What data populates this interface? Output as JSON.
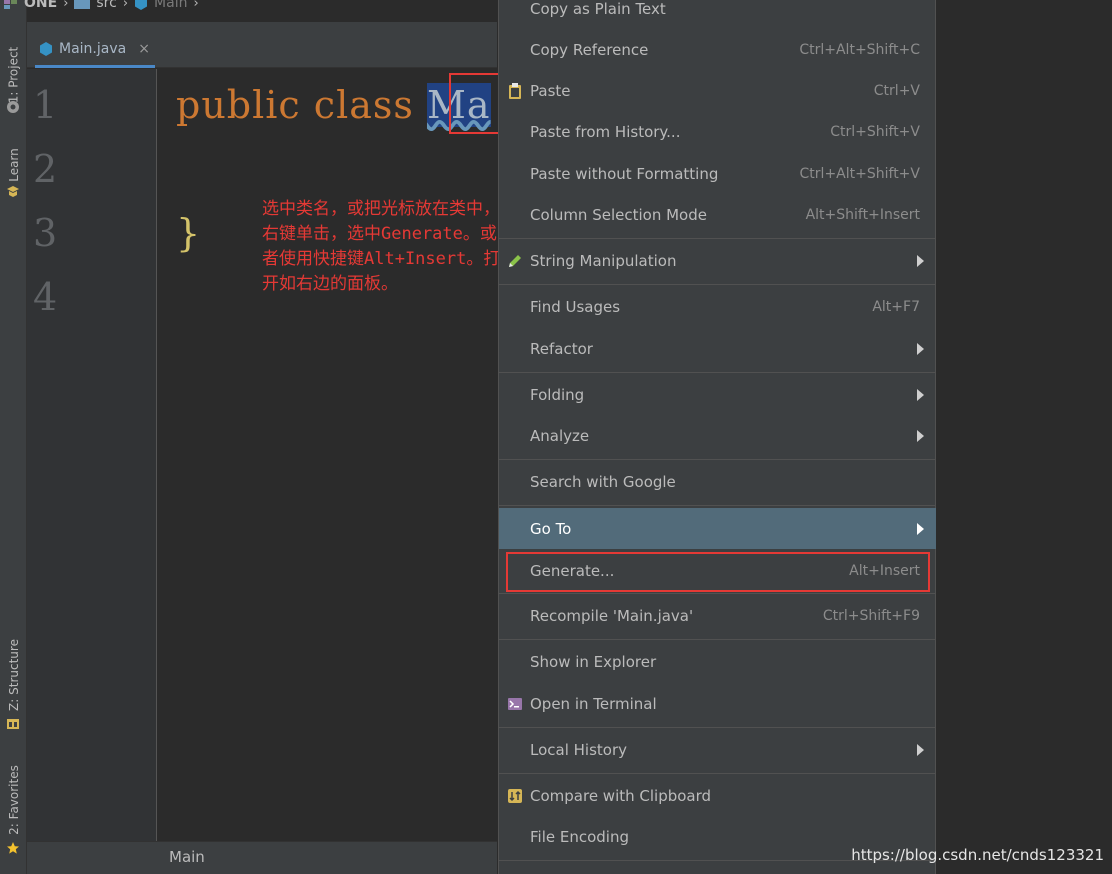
{
  "breadcrumb": {
    "project": "ONE",
    "folder": "src",
    "file": "Main"
  },
  "editor_tab": {
    "label": "Main.java",
    "close": "×"
  },
  "gutter": {
    "lines": [
      "1",
      "2",
      "3",
      "4"
    ]
  },
  "code": {
    "line1_keywords": "public class",
    "line1_class": "Ma",
    "line3_brace": "}"
  },
  "annotation": "选中类名，或把光标放在类中，右键单击，选中Generate。或者使用快捷键Alt+Insert。打开如右边的面板。",
  "left_strip": {
    "project_tab": "1: Project",
    "learn_tab": "Learn",
    "structure_tab": "Z: Structure",
    "favorites_tab": "2: Favorites"
  },
  "status": {
    "breadcrumb": "Main"
  },
  "menu": {
    "items": [
      {
        "label": "Copy as Plain Text",
        "shortcut": ""
      },
      {
        "label": "Copy Reference",
        "shortcut": "Ctrl+Alt+Shift+C"
      },
      {
        "label": "Paste",
        "shortcut": "Ctrl+V",
        "icon": "clipboard-icon"
      },
      {
        "label": "Paste from History...",
        "shortcut": "Ctrl+Shift+V"
      },
      {
        "label": "Paste without Formatting",
        "shortcut": "Ctrl+Alt+Shift+V"
      },
      {
        "label": "Column Selection Mode",
        "shortcut": "Alt+Shift+Insert"
      },
      {
        "label": "String Manipulation",
        "shortcut": "",
        "icon": "pencil-icon",
        "submenu": true
      },
      {
        "label": "Find Usages",
        "shortcut": "Alt+F7"
      },
      {
        "label": "Refactor",
        "shortcut": "",
        "submenu": true
      },
      {
        "label": "Folding",
        "shortcut": "",
        "submenu": true
      },
      {
        "label": "Analyze",
        "shortcut": "",
        "submenu": true
      },
      {
        "label": "Search with Google",
        "shortcut": ""
      },
      {
        "label": "Go To",
        "shortcut": "",
        "submenu": true,
        "selected": true
      },
      {
        "label": "Generate...",
        "shortcut": "Alt+Insert"
      },
      {
        "label": "Recompile 'Main.java'",
        "shortcut": "Ctrl+Shift+F9"
      },
      {
        "label": "Show in Explorer",
        "shortcut": ""
      },
      {
        "label": "Open in Terminal",
        "shortcut": "",
        "icon": "terminal-icon"
      },
      {
        "label": "Local History",
        "shortcut": "",
        "submenu": true
      },
      {
        "label": "Compare with Clipboard",
        "shortcut": "",
        "icon": "compare-icon"
      },
      {
        "label": "File Encoding",
        "shortcut": ""
      }
    ]
  },
  "watermark": "https://blog.csdn.net/cnds123321",
  "colors": {
    "keyword": "#cc7832",
    "selection": "#214283",
    "annotation": "#e53935",
    "menu_bg": "#3c3f41",
    "menu_selected": "#4b6eaf"
  }
}
